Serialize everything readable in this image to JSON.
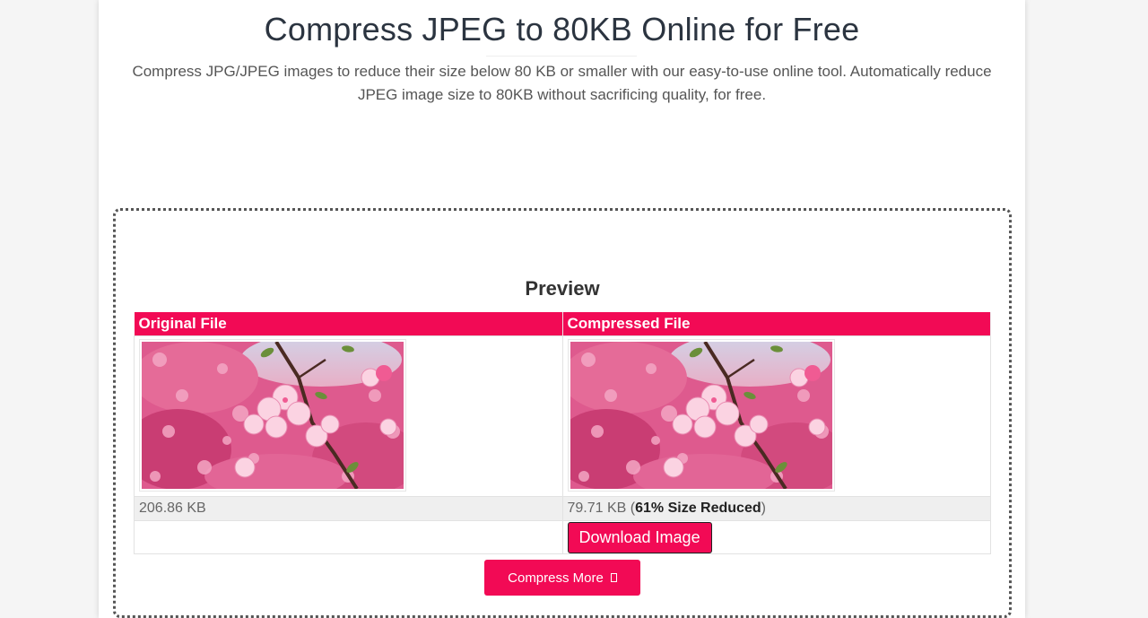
{
  "header": {
    "title": "Compress JPEG to 80KB Online for Free",
    "subtitle": "Compress JPG/JPEG images to reduce their size below 80 KB or smaller with our easy-to-use online tool. Automatically reduce JPEG image size to 80KB without sacrificing quality, for free."
  },
  "preview": {
    "heading": "Preview",
    "columns": [
      "Original File",
      "Compressed File"
    ],
    "original": {
      "size": "206.86 KB",
      "image_alt": "pink cherry blossom"
    },
    "compressed": {
      "size_prefix": "79.71 KB (",
      "reduction": "61% Size Reduced",
      "size_suffix": ")",
      "image_alt": "pink cherry blossom"
    },
    "download_label": "Download Image"
  },
  "actions": {
    "compress_more_label": "Compress More",
    "compress_more_icon": "refresh-icon"
  },
  "colors": {
    "accent": "#f20a55",
    "page_bg": "#f5f5f5",
    "card_bg": "#ffffff"
  }
}
